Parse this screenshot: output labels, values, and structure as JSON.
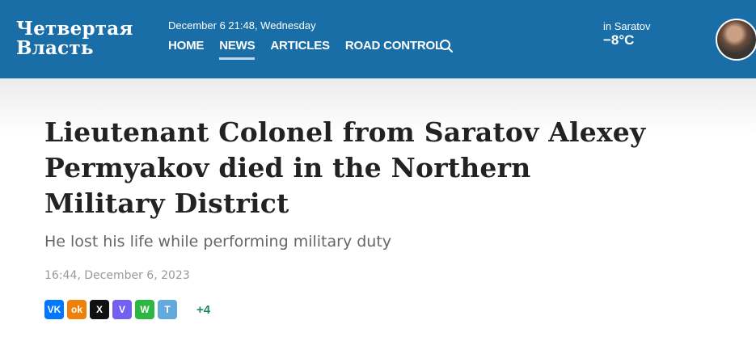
{
  "header": {
    "logo_line1": "Четвертая",
    "logo_line2": "Власть",
    "datetime": "December 6 21:48, Wednesday",
    "nav": [
      {
        "label": "HOME"
      },
      {
        "label": "NEWS",
        "active": true
      },
      {
        "label": "ARTICLES"
      },
      {
        "label": "ROAD CONTROL"
      }
    ],
    "search_icon": "search-icon",
    "weather": {
      "city": "in Saratov",
      "temp": "−8°C"
    },
    "colors": {
      "bar": "#1a6ea8",
      "text": "#ffffff"
    }
  },
  "article": {
    "title": "Lieutenant Colonel from Saratov Alexey Permyakov died in the Northern Military District",
    "subtitle": "He lost his life while performing military duty",
    "date": "16:44, December 6, 2023"
  },
  "share": {
    "buttons": [
      {
        "name": "vk-icon",
        "glyph": "VK",
        "color": "#0077ff"
      },
      {
        "name": "odnoklassniki-icon",
        "glyph": "ok",
        "color": "#ee8208"
      },
      {
        "name": "x-icon",
        "glyph": "X",
        "color": "#111111"
      },
      {
        "name": "viber-icon",
        "glyph": "V",
        "color": "#7360f2"
      },
      {
        "name": "whatsapp-icon",
        "glyph": "W",
        "color": "#2cb742"
      },
      {
        "name": "telegram-icon",
        "glyph": "T",
        "color": "#64a9dc"
      }
    ],
    "more": "+4"
  }
}
